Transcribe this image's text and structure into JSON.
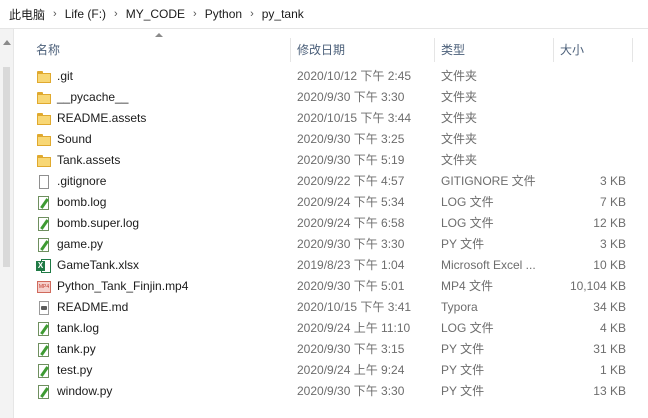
{
  "breadcrumb": [
    "此电脑",
    "Life (F:)",
    "MY_CODE",
    "Python",
    "py_tank"
  ],
  "columns": {
    "name": "名称",
    "date": "修改日期",
    "type": "类型",
    "size": "大小"
  },
  "files": [
    {
      "name": ".git",
      "date": "2020/10/12 下午 2:45",
      "type": "文件夹",
      "size": "",
      "icon": "folder"
    },
    {
      "name": "__pycache__",
      "date": "2020/9/30 下午 3:30",
      "type": "文件夹",
      "size": "",
      "icon": "folder"
    },
    {
      "name": "README.assets",
      "date": "2020/10/15 下午 3:44",
      "type": "文件夹",
      "size": "",
      "icon": "folder"
    },
    {
      "name": "Sound",
      "date": "2020/9/30 下午 3:25",
      "type": "文件夹",
      "size": "",
      "icon": "folder"
    },
    {
      "name": "Tank.assets",
      "date": "2020/9/30 下午 5:19",
      "type": "文件夹",
      "size": "",
      "icon": "folder"
    },
    {
      "name": ".gitignore",
      "date": "2020/9/22 下午 4:57",
      "type": "GITIGNORE 文件",
      "size": "3 KB",
      "icon": "file"
    },
    {
      "name": "bomb.log",
      "date": "2020/9/24 下午 5:34",
      "type": "LOG 文件",
      "size": "7 KB",
      "icon": "log"
    },
    {
      "name": "bomb.super.log",
      "date": "2020/9/24 下午 6:58",
      "type": "LOG 文件",
      "size": "12 KB",
      "icon": "log"
    },
    {
      "name": "game.py",
      "date": "2020/9/30 下午 3:30",
      "type": "PY 文件",
      "size": "3 KB",
      "icon": "log"
    },
    {
      "name": "GameTank.xlsx",
      "date": "2019/8/23 下午 1:04",
      "type": "Microsoft Excel ...",
      "size": "10 KB",
      "icon": "xlsx"
    },
    {
      "name": "Python_Tank_Finjin.mp4",
      "date": "2020/9/30 下午 5:01",
      "type": "MP4 文件",
      "size": "10,104 KB",
      "icon": "mp4"
    },
    {
      "name": "README.md",
      "date": "2020/10/15 下午 3:41",
      "type": "Typora",
      "size": "34 KB",
      "icon": "md"
    },
    {
      "name": "tank.log",
      "date": "2020/9/24 上午 11:10",
      "type": "LOG 文件",
      "size": "4 KB",
      "icon": "log"
    },
    {
      "name": "tank.py",
      "date": "2020/9/30 下午 3:15",
      "type": "PY 文件",
      "size": "31 KB",
      "icon": "log"
    },
    {
      "name": "test.py",
      "date": "2020/9/24 上午 9:24",
      "type": "PY 文件",
      "size": "1 KB",
      "icon": "log"
    },
    {
      "name": "window.py",
      "date": "2020/9/30 下午 3:30",
      "type": "PY 文件",
      "size": "13 KB",
      "icon": "log"
    }
  ]
}
